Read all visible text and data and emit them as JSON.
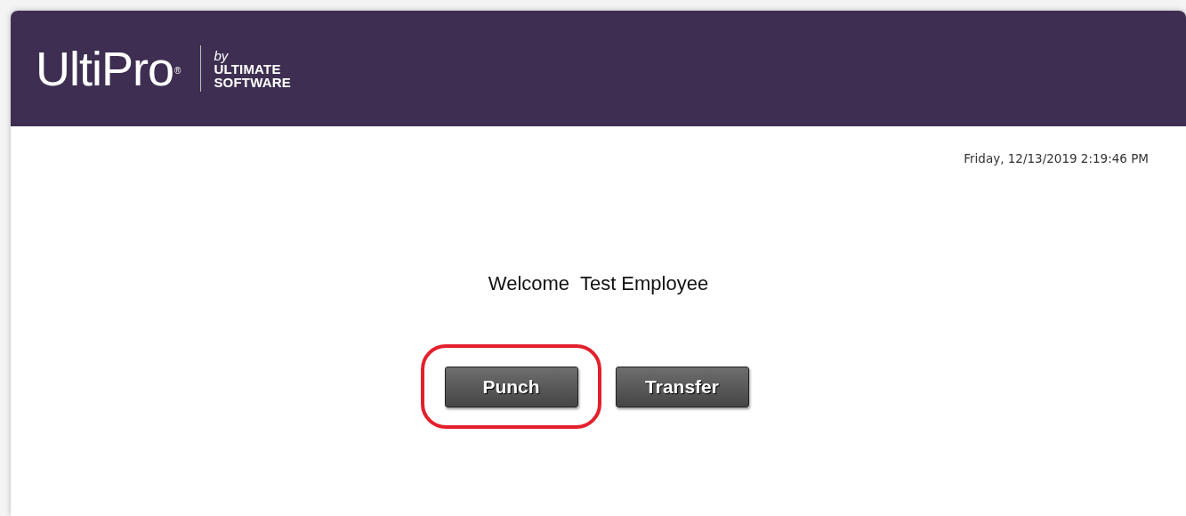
{
  "header": {
    "logo": {
      "name": "UltiPro",
      "mark": "®",
      "by": "by",
      "company_line_1": "ULTIMATE",
      "company_line_2": "SOFTWARE"
    }
  },
  "datetime": "Friday, 12/13/2019 2:19:46 PM",
  "welcome": "Welcome  Test Employee",
  "buttons": [
    {
      "label": "Punch",
      "highlighted": true
    },
    {
      "label": "Transfer",
      "highlighted": false
    }
  ]
}
